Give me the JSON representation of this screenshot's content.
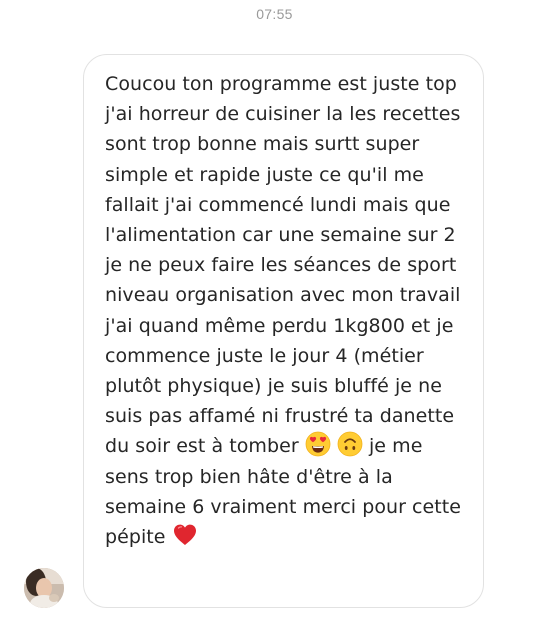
{
  "thread": {
    "timestamp": "07:55"
  },
  "message": {
    "sender": "contact",
    "segments": [
      {
        "type": "text",
        "value": "Coucou ton programme est juste top j'ai horreur de cuisiner la les recettes sont trop bonne mais surtt super simple et rapide juste ce qu'il me fallait j'ai commencé lundi mais que l'alimentation car une semaine sur 2 je ne peux faire les séances de sport niveau organisation avec mon travail j'ai quand même perdu 1kg800 et je commence juste le jour 4 (métier plutôt physique) je suis bluffé je ne suis pas affamé ni frustré ta danette du soir est à tomber "
      },
      {
        "type": "emoji",
        "icon": "heart-eyes-emoji-icon"
      },
      {
        "type": "text",
        "value": " "
      },
      {
        "type": "emoji",
        "icon": "upside-down-face-emoji-icon"
      },
      {
        "type": "text",
        "value": "  je me sens trop bien hâte d'être à la semaine 6 vraiment merci pour cette pépite "
      },
      {
        "type": "emoji",
        "icon": "red-heart-emoji-icon"
      }
    ]
  },
  "colors": {
    "bubble_border": "#e2e2e2",
    "text": "#262626",
    "timestamp": "#9a9a9a"
  }
}
